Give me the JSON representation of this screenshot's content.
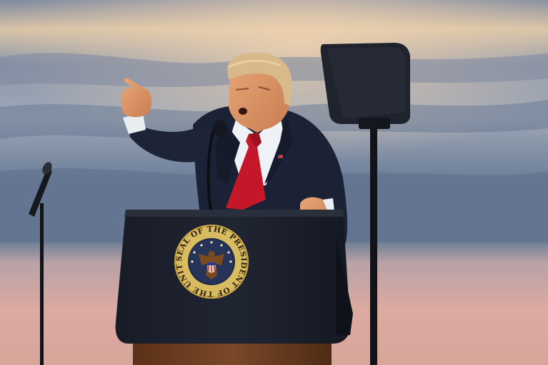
{
  "scene": {
    "seal": {
      "text": "SEAL OF THE PRESIDENT OF THE UNITED STATES",
      "colors": {
        "gold": "#c9a44a",
        "navy": "#1e2a4a",
        "eagle": "#7a4a20"
      }
    },
    "colors": {
      "sky_top": "#6f7c95",
      "sky_blue": "#5e7390",
      "sky_glow": "#e7c9a8",
      "horizon_pink": "#d9a9a4",
      "suit": "#1c2236",
      "tie": "#c4182a",
      "lectern": "#141823",
      "wood": "#6b3d22"
    }
  }
}
